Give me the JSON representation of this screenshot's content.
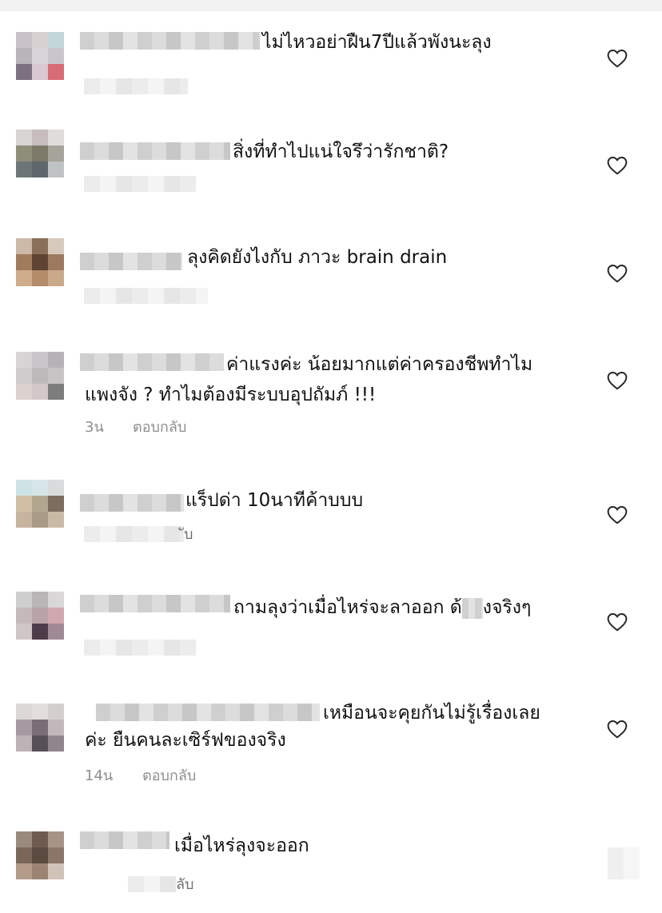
{
  "comments": [
    {
      "text": "ไม่ไหวอย่าฝืน7ปีแล้วพังนะลุง",
      "meta_time": "",
      "meta_reply": ""
    },
    {
      "text": "สิ่งที่ทำไปแน่ใจรึว่ารักชาติ?",
      "meta_time": "",
      "meta_reply": ""
    },
    {
      "text": "ลุงคิดยังไงกับ ภาวะ brain drain",
      "meta_time": "",
      "meta_reply": ""
    },
    {
      "text": "ค่าแรงค่ะ น้อยมากแต่ค่าครองชีพทำไม",
      "text2": "แพงจัง ? ทำไมต้องมีระบบอุปถัมภ์ !!!",
      "meta_time": "3น",
      "meta_reply": "ตอบกลับ"
    },
    {
      "text": "แร็ปด่า 10นาทีค้าบบบ",
      "meta_time": "",
      "meta_reply": "ับ"
    },
    {
      "text_a": "ถามลุงว่าเมื่อไหร่จะลาออก ด้",
      "text_b": "งจริงๆ",
      "meta_time": "",
      "meta_reply": ""
    },
    {
      "text": "เหมือนจะคุยกันไม่รู้เรื่องเลย",
      "text2": "ค่ะ ยืนคนละเซิร์ฟของจริง",
      "meta_time": "14น",
      "meta_reply": "ตอบกลับ"
    },
    {
      "text": "เมื่อไหร่ลุงจะออก",
      "meta_time": "",
      "meta_reply": "ลับ"
    }
  ],
  "icons": {
    "like": "heart-outline-icon"
  },
  "colors": {
    "text": "#111111",
    "meta": "#8e8e8e",
    "background": "#ffffff"
  }
}
